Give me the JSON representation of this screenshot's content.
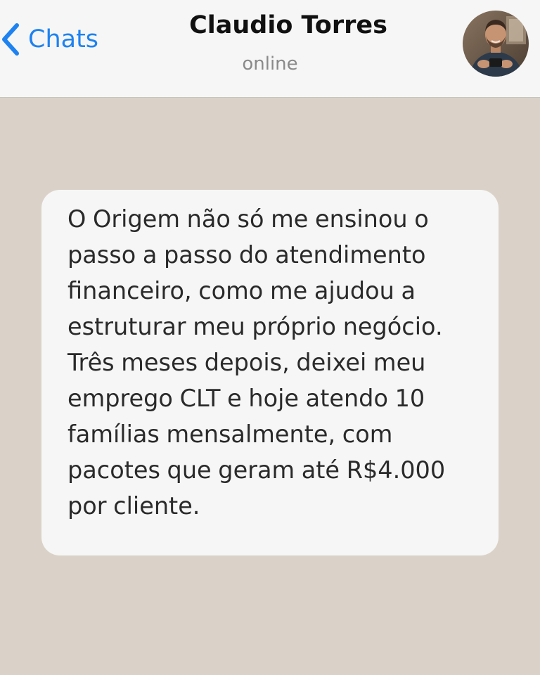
{
  "header": {
    "back_label": "Chats",
    "contact_name": "Claudio Torres",
    "status": "online"
  },
  "icons": {
    "back": "chevron-left-icon",
    "avatar": "contact-avatar-photo"
  },
  "colors": {
    "accent": "#1e82f0",
    "chat_background": "#dad2c8",
    "bubble_background": "#f6f6f6",
    "header_background": "#f6f6f6"
  },
  "messages": [
    {
      "text": "O Origem não só me ensinou o passo a passo do atendimento financeiro, como me ajudou a estruturar meu próprio negócio. Três meses depois, deixei meu emprego CLT e hoje atendo 10 famílias mensalmente, com pacotes que geram até R$4.000 por cliente."
    }
  ]
}
